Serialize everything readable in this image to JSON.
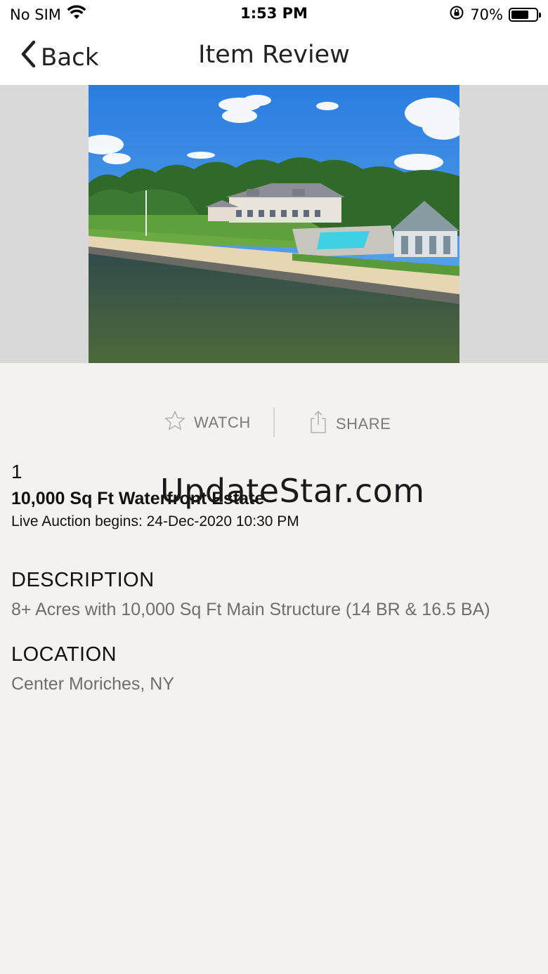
{
  "status_bar": {
    "carrier": "No SIM",
    "time": "1:53 PM",
    "battery_percent": "70%",
    "battery_level": 0.7
  },
  "nav": {
    "back_label": "Back",
    "title": "Item Review"
  },
  "actions": {
    "watch_label": "WATCH",
    "share_label": "SHARE"
  },
  "item": {
    "lot_number": "1",
    "title": "10,000 Sq Ft Waterfront Estate",
    "auction_time": "Live Auction begins: 24-Dec-2020 10:30 PM"
  },
  "description": {
    "heading": "DESCRIPTION",
    "text": "8+ Acres with 10,000 Sq Ft Main Structure (14 BR & 16.5 BA)"
  },
  "location": {
    "heading": "LOCATION",
    "text": "Center Moriches, NY"
  },
  "watermark": "UpdateStar.com",
  "colors": {
    "background": "#f3f2ef",
    "bar": "#ffffff",
    "image_strip": "#d9d9d9",
    "muted_text": "#6e6e6e"
  },
  "icons": [
    "wifi-icon",
    "orientation-lock-icon",
    "battery-icon",
    "chevron-left-icon",
    "star-icon",
    "share-icon"
  ]
}
